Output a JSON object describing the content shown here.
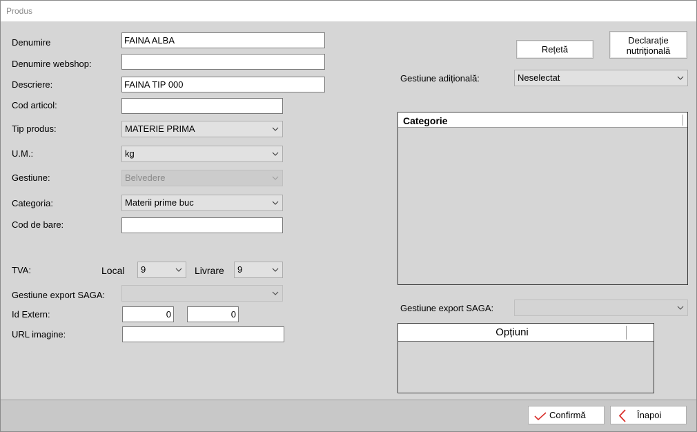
{
  "window": {
    "title": "Produs"
  },
  "labels": {
    "denumire": "Denumire",
    "denumire_webshop": "Denumire webshop:",
    "descriere": "Descriere:",
    "cod_articol": "Cod articol:",
    "tip_produs": "Tip produs:",
    "um": "U.M.:",
    "gestiune": "Gestiune:",
    "categoria": "Categoria:",
    "cod_bare": "Cod de bare:",
    "tva": "TVA:",
    "local": "Local",
    "livrare": "Livrare",
    "gestiune_export_saga": "Gestiune export SAGA:",
    "id_extern": "Id Extern:",
    "url_imagine": "URL imagine:",
    "gestiune_aditionala": "Gestiune adițională:",
    "gestiune_export_saga_right": "Gestiune export SAGA:"
  },
  "fields": {
    "denumire": "FAINA ALBA",
    "denumire_webshop": "",
    "descriere": "FAINA TIP 000",
    "cod_articol": "",
    "tip_produs": "MATERIE PRIMA",
    "um": "kg",
    "gestiune": "Belvedere",
    "categoria": "Materii prime buc",
    "cod_bare": "",
    "tva_local": "9",
    "tva_livrare": "9",
    "gestiune_export_saga": "",
    "id_extern_1": "0",
    "id_extern_2": "0",
    "url_imagine": "",
    "gestiune_aditionala": "Neselectat",
    "gestiune_export_saga_right": ""
  },
  "buttons": {
    "reteta": "Rețetă",
    "declaratie_line1": "Declarație",
    "declaratie_line2": "nutrițională",
    "confirma": "Confirmă",
    "inapoi": "Înapoi"
  },
  "categorie_grid": {
    "header": "Categorie"
  },
  "optiuni_grid": {
    "header": "Opțiuni"
  },
  "colors": {
    "confirm_icon": "#d9302c",
    "back_icon": "#d9302c"
  }
}
